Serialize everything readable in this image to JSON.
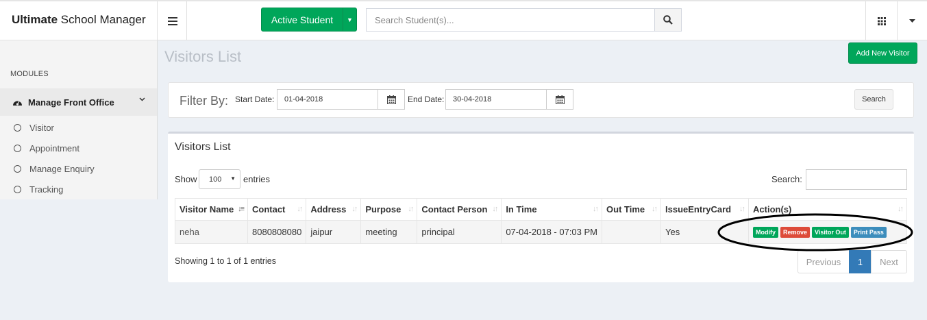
{
  "brand": {
    "bold": "Ultimate",
    "rest": " School Manager"
  },
  "header": {
    "active_label": "Active Student",
    "search_placeholder": "Search Student(s)..."
  },
  "sidebar": {
    "section": "MODULES",
    "menu": "Manage Front Office",
    "items": [
      "Visitor",
      "Appointment",
      "Manage Enquiry",
      "Tracking"
    ]
  },
  "page": {
    "title": "Visitors List",
    "add_button": "Add New Visitor"
  },
  "filter": {
    "label": "Filter By:",
    "start_label": "Start Date:",
    "start_value": "01-04-2018",
    "end_label": "End Date:",
    "end_value": "30-04-2018",
    "search_button": "Search"
  },
  "list": {
    "title": "Visitors List",
    "show_label": "Show",
    "entries_value": "100",
    "entries_label": "entries",
    "search_label": "Search:",
    "columns": [
      "Visitor Name",
      "Contact",
      "Address",
      "Purpose",
      "Contact Person",
      "In Time",
      "Out Time",
      "IssueEntryCard",
      "Action(s)"
    ],
    "rows": [
      {
        "name": "neha",
        "contact": "8080808080",
        "address": "jaipur",
        "purpose": "meeting",
        "person": "principal",
        "in_time": "07-04-2018 - 07:03 PM",
        "out_time": "",
        "card": "Yes"
      }
    ],
    "actions": [
      {
        "label": "Modify",
        "color": "#00a65a"
      },
      {
        "label": "Remove",
        "color": "#dd4b39"
      },
      {
        "label": "Visitor Out",
        "color": "#00a65a"
      },
      {
        "label": "Print Pass",
        "color": "#3c8dbc"
      }
    ],
    "summary": "Showing 1 to 1 of 1 entries",
    "pagination": {
      "prev": "Previous",
      "page": "1",
      "next": "Next"
    }
  },
  "colors": {
    "green": "#00a65a",
    "red": "#dd4b39",
    "blue": "#3c8dbc",
    "page_active": "#337ab7"
  }
}
